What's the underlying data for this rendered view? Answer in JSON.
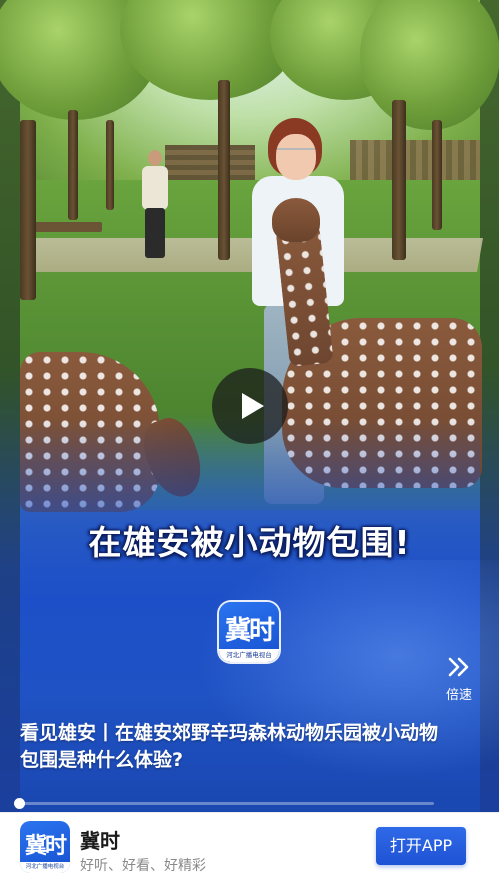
{
  "video": {
    "headline": "在雄安被小动物包围!",
    "logo_glyph": "冀时",
    "logo_strip": "河北广播电视台",
    "caption": "看见雄安丨在雄安郊野辛玛森林动物乐园被小动物包围是种什么体验?",
    "speed_label": "倍速",
    "progress_fraction": 0.0
  },
  "app_bar": {
    "app_name": "冀时",
    "tagline": "好听、好看、好精彩",
    "icon_glyph": "冀时",
    "icon_strip": "河北广播电视台",
    "open_button": "打开APP"
  },
  "icons": {
    "play": "play-icon",
    "speed": "double-chevron-right-icon"
  },
  "colors": {
    "brand_blue": "#1f52d4",
    "overlay_blue": "#1f52c4"
  }
}
